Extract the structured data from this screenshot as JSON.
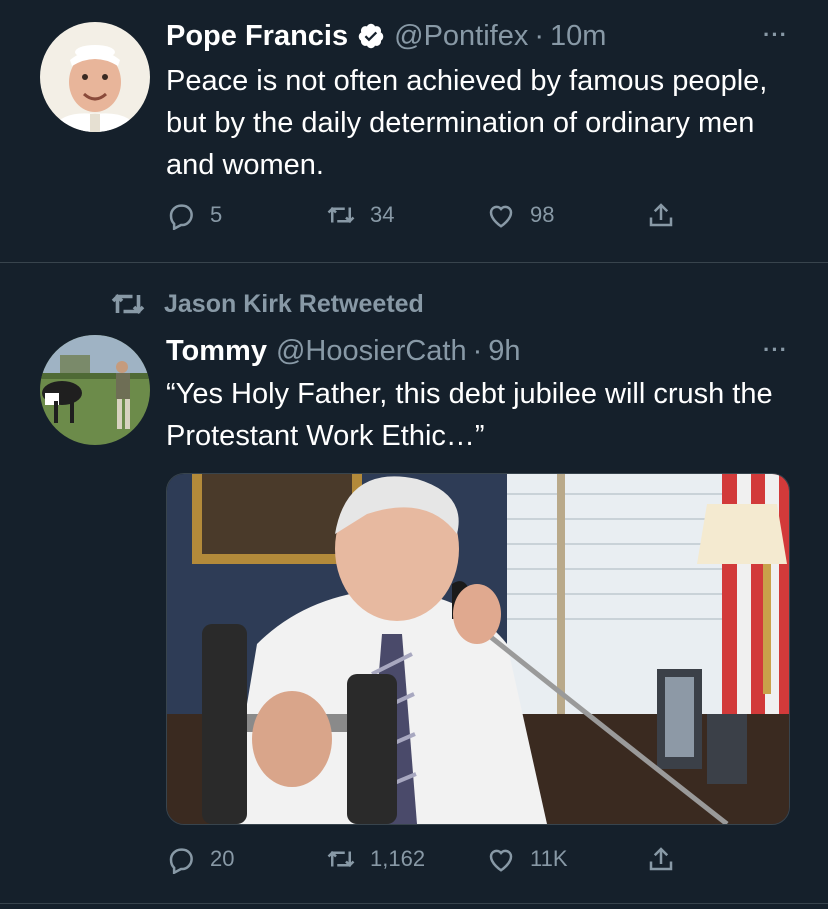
{
  "tweets": [
    {
      "author_name": "Pope Francis",
      "verified": true,
      "handle": "@Pontifex",
      "separator": "·",
      "time": "10m",
      "text": "Peace is not often achieved by famous people, but by the daily determination of ordinary men and women.",
      "replies": "5",
      "retweets": "34",
      "likes": "98"
    },
    {
      "retweeted_by": "Jason Kirk Retweeted",
      "author_name": "Tommy",
      "handle": "@HoosierCath",
      "separator": "·",
      "time": "9h",
      "text": "“Yes Holy Father, this debt jubilee will crush the Protestant Work Ethic…”",
      "replies": "20",
      "retweets": "1,162",
      "likes": "11K",
      "has_media": true
    }
  ],
  "more_label": "···",
  "icons": {
    "reply": "reply-icon",
    "retweet": "retweet-icon",
    "like": "heart-icon",
    "share": "share-icon",
    "verified": "verified-badge-icon"
  },
  "colors": {
    "background": "#15202b",
    "text": "#ffffff",
    "secondary": "#8899a6",
    "divider": "#38444d",
    "verified": "#ffffff"
  }
}
